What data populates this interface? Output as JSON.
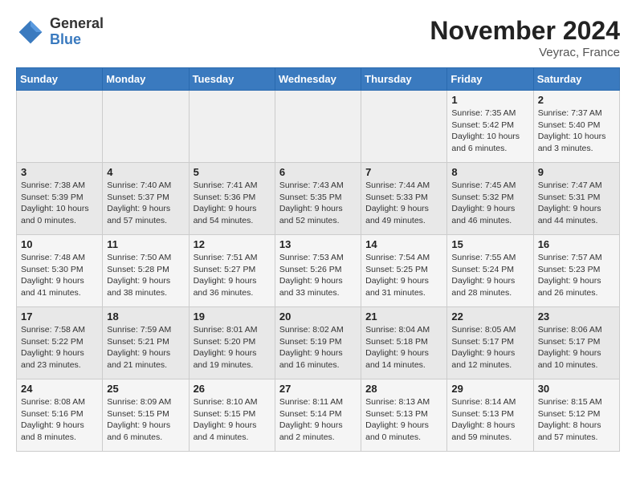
{
  "logo": {
    "general": "General",
    "blue": "Blue"
  },
  "title": "November 2024",
  "location": "Veyrac, France",
  "days_header": [
    "Sunday",
    "Monday",
    "Tuesday",
    "Wednesday",
    "Thursday",
    "Friday",
    "Saturday"
  ],
  "weeks": [
    [
      {
        "day": "",
        "info": ""
      },
      {
        "day": "",
        "info": ""
      },
      {
        "day": "",
        "info": ""
      },
      {
        "day": "",
        "info": ""
      },
      {
        "day": "",
        "info": ""
      },
      {
        "day": "1",
        "info": "Sunrise: 7:35 AM\nSunset: 5:42 PM\nDaylight: 10 hours\nand 6 minutes."
      },
      {
        "day": "2",
        "info": "Sunrise: 7:37 AM\nSunset: 5:40 PM\nDaylight: 10 hours\nand 3 minutes."
      }
    ],
    [
      {
        "day": "3",
        "info": "Sunrise: 7:38 AM\nSunset: 5:39 PM\nDaylight: 10 hours\nand 0 minutes."
      },
      {
        "day": "4",
        "info": "Sunrise: 7:40 AM\nSunset: 5:37 PM\nDaylight: 9 hours\nand 57 minutes."
      },
      {
        "day": "5",
        "info": "Sunrise: 7:41 AM\nSunset: 5:36 PM\nDaylight: 9 hours\nand 54 minutes."
      },
      {
        "day": "6",
        "info": "Sunrise: 7:43 AM\nSunset: 5:35 PM\nDaylight: 9 hours\nand 52 minutes."
      },
      {
        "day": "7",
        "info": "Sunrise: 7:44 AM\nSunset: 5:33 PM\nDaylight: 9 hours\nand 49 minutes."
      },
      {
        "day": "8",
        "info": "Sunrise: 7:45 AM\nSunset: 5:32 PM\nDaylight: 9 hours\nand 46 minutes."
      },
      {
        "day": "9",
        "info": "Sunrise: 7:47 AM\nSunset: 5:31 PM\nDaylight: 9 hours\nand 44 minutes."
      }
    ],
    [
      {
        "day": "10",
        "info": "Sunrise: 7:48 AM\nSunset: 5:30 PM\nDaylight: 9 hours\nand 41 minutes."
      },
      {
        "day": "11",
        "info": "Sunrise: 7:50 AM\nSunset: 5:28 PM\nDaylight: 9 hours\nand 38 minutes."
      },
      {
        "day": "12",
        "info": "Sunrise: 7:51 AM\nSunset: 5:27 PM\nDaylight: 9 hours\nand 36 minutes."
      },
      {
        "day": "13",
        "info": "Sunrise: 7:53 AM\nSunset: 5:26 PM\nDaylight: 9 hours\nand 33 minutes."
      },
      {
        "day": "14",
        "info": "Sunrise: 7:54 AM\nSunset: 5:25 PM\nDaylight: 9 hours\nand 31 minutes."
      },
      {
        "day": "15",
        "info": "Sunrise: 7:55 AM\nSunset: 5:24 PM\nDaylight: 9 hours\nand 28 minutes."
      },
      {
        "day": "16",
        "info": "Sunrise: 7:57 AM\nSunset: 5:23 PM\nDaylight: 9 hours\nand 26 minutes."
      }
    ],
    [
      {
        "day": "17",
        "info": "Sunrise: 7:58 AM\nSunset: 5:22 PM\nDaylight: 9 hours\nand 23 minutes."
      },
      {
        "day": "18",
        "info": "Sunrise: 7:59 AM\nSunset: 5:21 PM\nDaylight: 9 hours\nand 21 minutes."
      },
      {
        "day": "19",
        "info": "Sunrise: 8:01 AM\nSunset: 5:20 PM\nDaylight: 9 hours\nand 19 minutes."
      },
      {
        "day": "20",
        "info": "Sunrise: 8:02 AM\nSunset: 5:19 PM\nDaylight: 9 hours\nand 16 minutes."
      },
      {
        "day": "21",
        "info": "Sunrise: 8:04 AM\nSunset: 5:18 PM\nDaylight: 9 hours\nand 14 minutes."
      },
      {
        "day": "22",
        "info": "Sunrise: 8:05 AM\nSunset: 5:17 PM\nDaylight: 9 hours\nand 12 minutes."
      },
      {
        "day": "23",
        "info": "Sunrise: 8:06 AM\nSunset: 5:17 PM\nDaylight: 9 hours\nand 10 minutes."
      }
    ],
    [
      {
        "day": "24",
        "info": "Sunrise: 8:08 AM\nSunset: 5:16 PM\nDaylight: 9 hours\nand 8 minutes."
      },
      {
        "day": "25",
        "info": "Sunrise: 8:09 AM\nSunset: 5:15 PM\nDaylight: 9 hours\nand 6 minutes."
      },
      {
        "day": "26",
        "info": "Sunrise: 8:10 AM\nSunset: 5:15 PM\nDaylight: 9 hours\nand 4 minutes."
      },
      {
        "day": "27",
        "info": "Sunrise: 8:11 AM\nSunset: 5:14 PM\nDaylight: 9 hours\nand 2 minutes."
      },
      {
        "day": "28",
        "info": "Sunrise: 8:13 AM\nSunset: 5:13 PM\nDaylight: 9 hours\nand 0 minutes."
      },
      {
        "day": "29",
        "info": "Sunrise: 8:14 AM\nSunset: 5:13 PM\nDaylight: 8 hours\nand 59 minutes."
      },
      {
        "day": "30",
        "info": "Sunrise: 8:15 AM\nSunset: 5:12 PM\nDaylight: 8 hours\nand 57 minutes."
      }
    ]
  ]
}
